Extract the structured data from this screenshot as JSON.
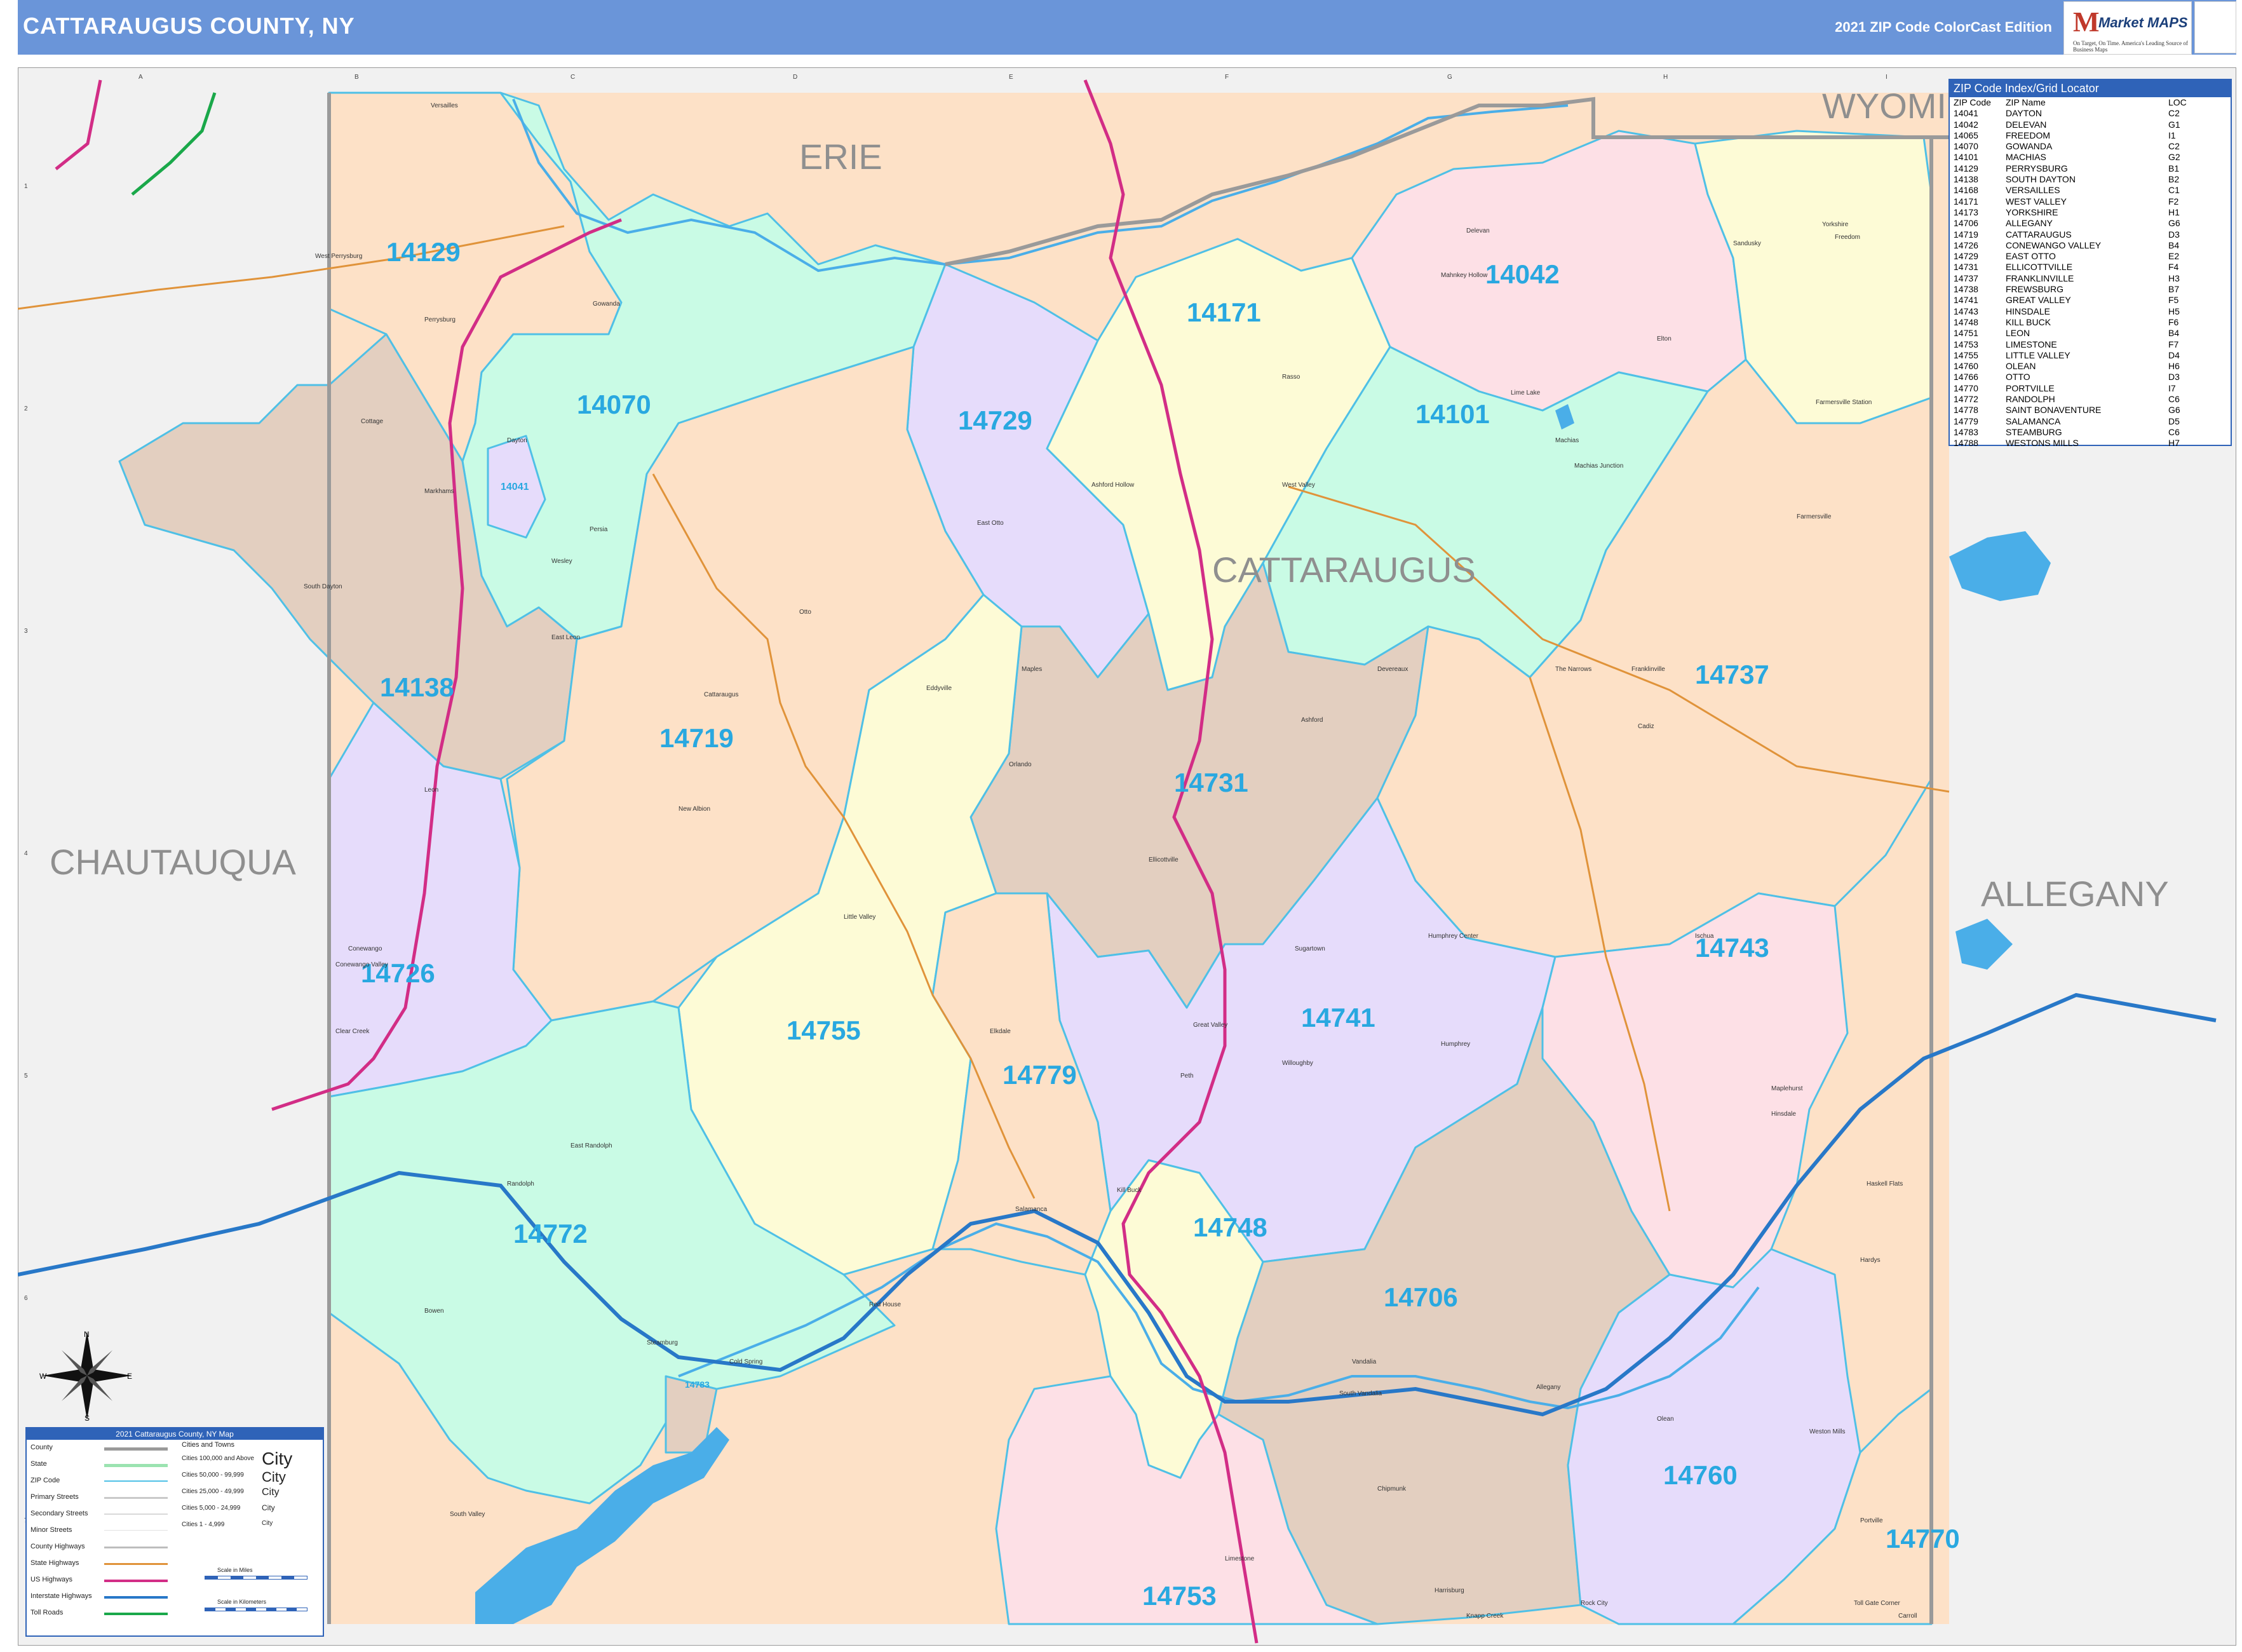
{
  "header": {
    "title": "CATTARAUGUS COUNTY, NY",
    "edition": "2021 ZIP Code ColorCast Edition",
    "logo_text": "Market MAPS",
    "logo_tagline": "On Target, On Time. America's Leading Source of Business Maps"
  },
  "colors": {
    "header_bg": "#6a95d9",
    "zip_label": "#29a8e0",
    "zip_border": "#4fc0e6",
    "peach": "#fde1c7",
    "mint": "#c9fbe5",
    "lavender": "#e6dcfb",
    "yellow": "#fdfbd6",
    "pink": "#fde0e6",
    "tan": "#e3cfc0",
    "outside": "#f1f1f1",
    "water": "#4aaee8",
    "interstate": "#2878c8",
    "us_highway": "#d22d86",
    "state_highway": "#e0933a"
  },
  "counties": [
    "ERIE",
    "WYOMI",
    "CATTARAUGUS",
    "CHAUTAUQUA",
    "ALLEGANY"
  ],
  "zips": [
    {
      "code": "14129",
      "color": "peach"
    },
    {
      "code": "14070",
      "color": "mint"
    },
    {
      "code": "14041",
      "color": "lavender"
    },
    {
      "code": "14729",
      "color": "lavender"
    },
    {
      "code": "14171",
      "color": "yellow"
    },
    {
      "code": "14042",
      "color": "pink"
    },
    {
      "code": "14101",
      "color": "mint"
    },
    {
      "code": "14138",
      "color": "tan"
    },
    {
      "code": "14719",
      "color": "peach"
    },
    {
      "code": "14731",
      "color": "tan"
    },
    {
      "code": "14737",
      "color": "peach"
    },
    {
      "code": "14726",
      "color": "lavender"
    },
    {
      "code": "14755",
      "color": "yellow"
    },
    {
      "code": "14741",
      "color": "lavender"
    },
    {
      "code": "14743",
      "color": "pink"
    },
    {
      "code": "14779",
      "color": "peach"
    },
    {
      "code": "14772",
      "color": "mint"
    },
    {
      "code": "14748",
      "color": "yellow"
    },
    {
      "code": "14706",
      "color": "tan"
    },
    {
      "code": "14760",
      "color": "lavender"
    },
    {
      "code": "14770",
      "color": "peach"
    },
    {
      "code": "14753",
      "color": "pink"
    },
    {
      "code": "14783",
      "color": "tan"
    },
    {
      "code": "14065",
      "color": "yellow"
    }
  ],
  "towns": [
    "Versailles",
    "West Perrysburg",
    "Perrysburg",
    "Gowanda",
    "Dayton",
    "Cottage",
    "Markhams",
    "Persia",
    "Wesley",
    "South Dayton",
    "East Leon",
    "Leon",
    "Cattaraugus",
    "New Albion",
    "Otto",
    "East Otto",
    "Ashford Hollow",
    "West Valley",
    "Delevan",
    "Yorkshire",
    "Sandusky",
    "Freedom",
    "Elton",
    "Machias",
    "Lime Lake",
    "Machias Junction",
    "Farmersville",
    "Farmersville Station",
    "Mahnkey Hollow",
    "Rasso",
    "Ashford",
    "Ellicottville",
    "Devereaux",
    "Franklinville",
    "Cadiz",
    "The Narrows",
    "Maples",
    "Eddyville",
    "Orlando",
    "Little Valley",
    "Conewango",
    "Conewango Valley",
    "Clear Creek",
    "Randolph",
    "East Randolph",
    "Bowen",
    "Steamburg",
    "Red House",
    "Cold Spring",
    "Salamanca",
    "Kill Buck",
    "Great Valley",
    "Peth",
    "Sugartown",
    "Humphrey Center",
    "Humphrey",
    "Willoughby",
    "Ischua",
    "Hinsdale",
    "Maplehurst",
    "Haskell Flats",
    "Hardys",
    "Allegany",
    "Vandalia",
    "South Vandalia",
    "Olean",
    "Chipmunk",
    "Knapp Creek",
    "Limestone",
    "Harrisburg",
    "Rock City",
    "Toll Gate Corner",
    "Portville",
    "Carroll",
    "Weston Mills",
    "South Valley",
    "Elkdale",
    "Onoville",
    "Bakerstand",
    "Abbotts",
    "Haydenville",
    "Ashford Junction",
    "Fourmile",
    "Wesgate",
    "Eagle Falls"
  ],
  "grid_columns": [
    "A",
    "B",
    "C",
    "D",
    "E",
    "F",
    "G",
    "H",
    "I"
  ],
  "grid_rows": [
    "1",
    "2",
    "3",
    "4",
    "5",
    "6",
    "7"
  ],
  "index": {
    "title": "ZIP Code Index/Grid Locator",
    "col_zip": "ZIP Code",
    "col_name": "ZIP Name",
    "col_loc": "LOC",
    "rows": [
      [
        "14041",
        "DAYTON",
        "C2"
      ],
      [
        "14042",
        "DELEVAN",
        "G1"
      ],
      [
        "14065",
        "FREEDOM",
        "I1"
      ],
      [
        "14070",
        "GOWANDA",
        "C2"
      ],
      [
        "14101",
        "MACHIAS",
        "G2"
      ],
      [
        "14129",
        "PERRYSBURG",
        "B1"
      ],
      [
        "14138",
        "SOUTH DAYTON",
        "B2"
      ],
      [
        "14168",
        "VERSAILLES",
        "C1"
      ],
      [
        "14171",
        "WEST VALLEY",
        "F2"
      ],
      [
        "14173",
        "YORKSHIRE",
        "H1"
      ],
      [
        "14706",
        "ALLEGANY",
        "G6"
      ],
      [
        "14719",
        "CATTARAUGUS",
        "D3"
      ],
      [
        "14726",
        "CONEWANGO VALLEY",
        "B4"
      ],
      [
        "14729",
        "EAST OTTO",
        "E2"
      ],
      [
        "14731",
        "ELLICOTTVILLE",
        "F4"
      ],
      [
        "14737",
        "FRANKLINVILLE",
        "H3"
      ],
      [
        "14738",
        "FREWSBURG",
        "B7"
      ],
      [
        "14741",
        "GREAT VALLEY",
        "F5"
      ],
      [
        "14743",
        "HINSDALE",
        "H5"
      ],
      [
        "14748",
        "KILL BUCK",
        "F6"
      ],
      [
        "14751",
        "LEON",
        "B4"
      ],
      [
        "14753",
        "LIMESTONE",
        "F7"
      ],
      [
        "14755",
        "LITTLE VALLEY",
        "D4"
      ],
      [
        "14760",
        "OLEAN",
        "H6"
      ],
      [
        "14766",
        "OTTO",
        "D3"
      ],
      [
        "14770",
        "PORTVILLE",
        "I7"
      ],
      [
        "14772",
        "RANDOLPH",
        "C6"
      ],
      [
        "14778",
        "SAINT BONAVENTURE",
        "G6"
      ],
      [
        "14779",
        "SALAMANCA",
        "D5"
      ],
      [
        "14783",
        "STEAMBURG",
        "C6"
      ],
      [
        "14788",
        "WESTONS MILLS",
        "H7"
      ]
    ]
  },
  "legend": {
    "title": "2021 Cattaraugus County, NY Map",
    "rows": [
      "County",
      "State",
      "ZIP Code",
      "Primary Streets",
      "Secondary Streets",
      "Minor Streets",
      "County Highways",
      "State Highways",
      "US Highways",
      "Interstate Highways",
      "Toll Roads"
    ],
    "city_heading": "Cities and Towns",
    "city_rows": [
      "Cities 100,000 and Above",
      "Cities 50,000 - 99,999",
      "Cities 25,000 - 49,999",
      "Cities 5,000 - 24,999",
      "Cities 1 - 4,999"
    ],
    "city_samples": [
      "City",
      "City",
      "City",
      "City",
      "City"
    ],
    "scale_miles": "Scale in Miles",
    "scale_km": "Scale in Kilometers"
  },
  "compass_labels": [
    "N",
    "S",
    "E",
    "W"
  ]
}
